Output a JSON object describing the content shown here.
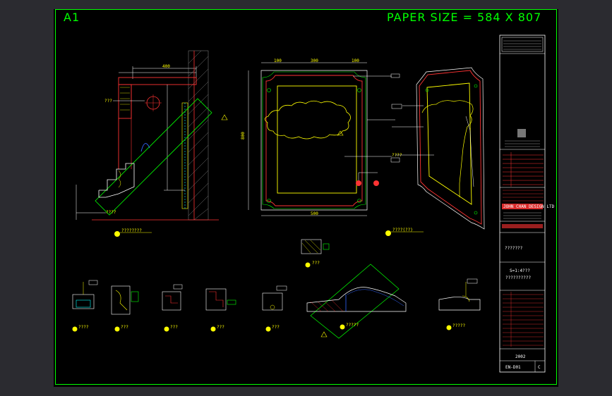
{
  "sheet": {
    "id": "A1",
    "paper_size": "PAPER SIZE = 584 X 807"
  },
  "callouts": {
    "section_main": "????????",
    "elevation_main": "????(??)",
    "detail_small": "???",
    "detail_1": "????",
    "detail_2": "???",
    "detail_3": "???",
    "detail_4": "???",
    "detail_5": "???",
    "detail_6": "?????",
    "detail_7": "?????",
    "tag_left": "???"
  },
  "title_block": {
    "company": "JOHN CHAN DESIGN LTD",
    "drawing_title": "???????",
    "scale_text": "S=1:4???",
    "scale_sub": "??????????",
    "year": "2002",
    "drawing_no": "EN-D01",
    "revision": "C"
  }
}
